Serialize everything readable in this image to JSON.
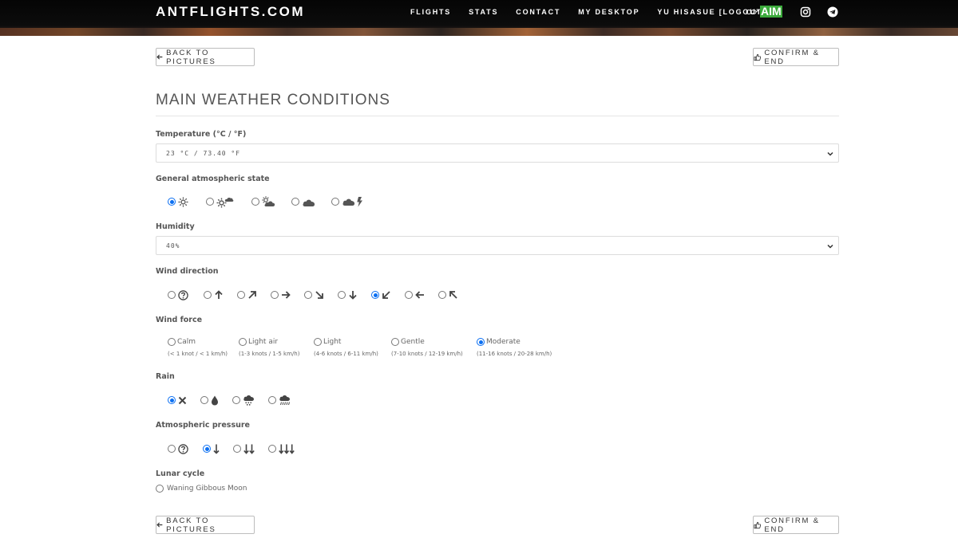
{
  "navbar": {
    "brand": "ANTFLIGHTS.COM",
    "links": [
      "FLIGHTS",
      "STATS",
      "CONTACT",
      "MY DESKTOP",
      "YU HISASUE [LOGOUT]"
    ],
    "partner_logo_text": "AIM",
    "social_icons": [
      "instagram-icon",
      "telegram-icon"
    ]
  },
  "buttons": {
    "back": "BACK TO PICTURES",
    "confirm": "CONFIRM & END"
  },
  "page_title": "MAIN WEATHER CONDITIONS",
  "temperature": {
    "label": "Temperature (°C / °F)",
    "value": "23 °C / 73.40 °F"
  },
  "atmospheric_state": {
    "label": "General atmospheric state",
    "options": [
      "sun-icon",
      "sun-cloud-icon",
      "partly-cloudy-icon",
      "cloud-icon",
      "storm-icon"
    ],
    "selected": 0
  },
  "humidity": {
    "label": "Humidity",
    "value": "40%"
  },
  "wind_direction": {
    "label": "Wind direction",
    "options": [
      "question-icon",
      "arrow-up-icon",
      "arrow-up-right-icon",
      "arrow-right-icon",
      "arrow-down-right-icon",
      "arrow-down-icon",
      "arrow-down-left-icon",
      "arrow-left-icon",
      "arrow-up-left-icon"
    ],
    "selected": 6
  },
  "wind_force": {
    "label": "Wind force",
    "options": [
      {
        "name": "Calm",
        "range": "(< 1 knot / < 1 km/h)"
      },
      {
        "name": "Light air",
        "range": "(1-3 knots / 1-5 km/h)"
      },
      {
        "name": "Light",
        "range": "(4-6 knots / 6-11 km/h)"
      },
      {
        "name": "Gentle",
        "range": "(7-10 knots / 12-19 km/h)"
      },
      {
        "name": "Moderate",
        "range": "(11-16 knots / 20-28 km/h)"
      }
    ],
    "selected": 4
  },
  "rain": {
    "label": "Rain",
    "options": [
      "no-rain-icon",
      "drop-icon",
      "cloud-rain-icon",
      "cloud-heavy-rain-icon"
    ],
    "selected": 0
  },
  "pressure": {
    "label": "Atmospheric pressure",
    "options": [
      "question-icon",
      "one-arrow-down-icon",
      "two-arrows-down-icon",
      "three-arrows-down-icon"
    ],
    "selected": 1
  },
  "lunar": {
    "label": "Lunar cycle",
    "value": "Waning Gibbous Moon"
  },
  "colors": {
    "accent": "#0b6ff2",
    "partner_green": "#3caa3c",
    "navbar": "#0a0a0a"
  }
}
